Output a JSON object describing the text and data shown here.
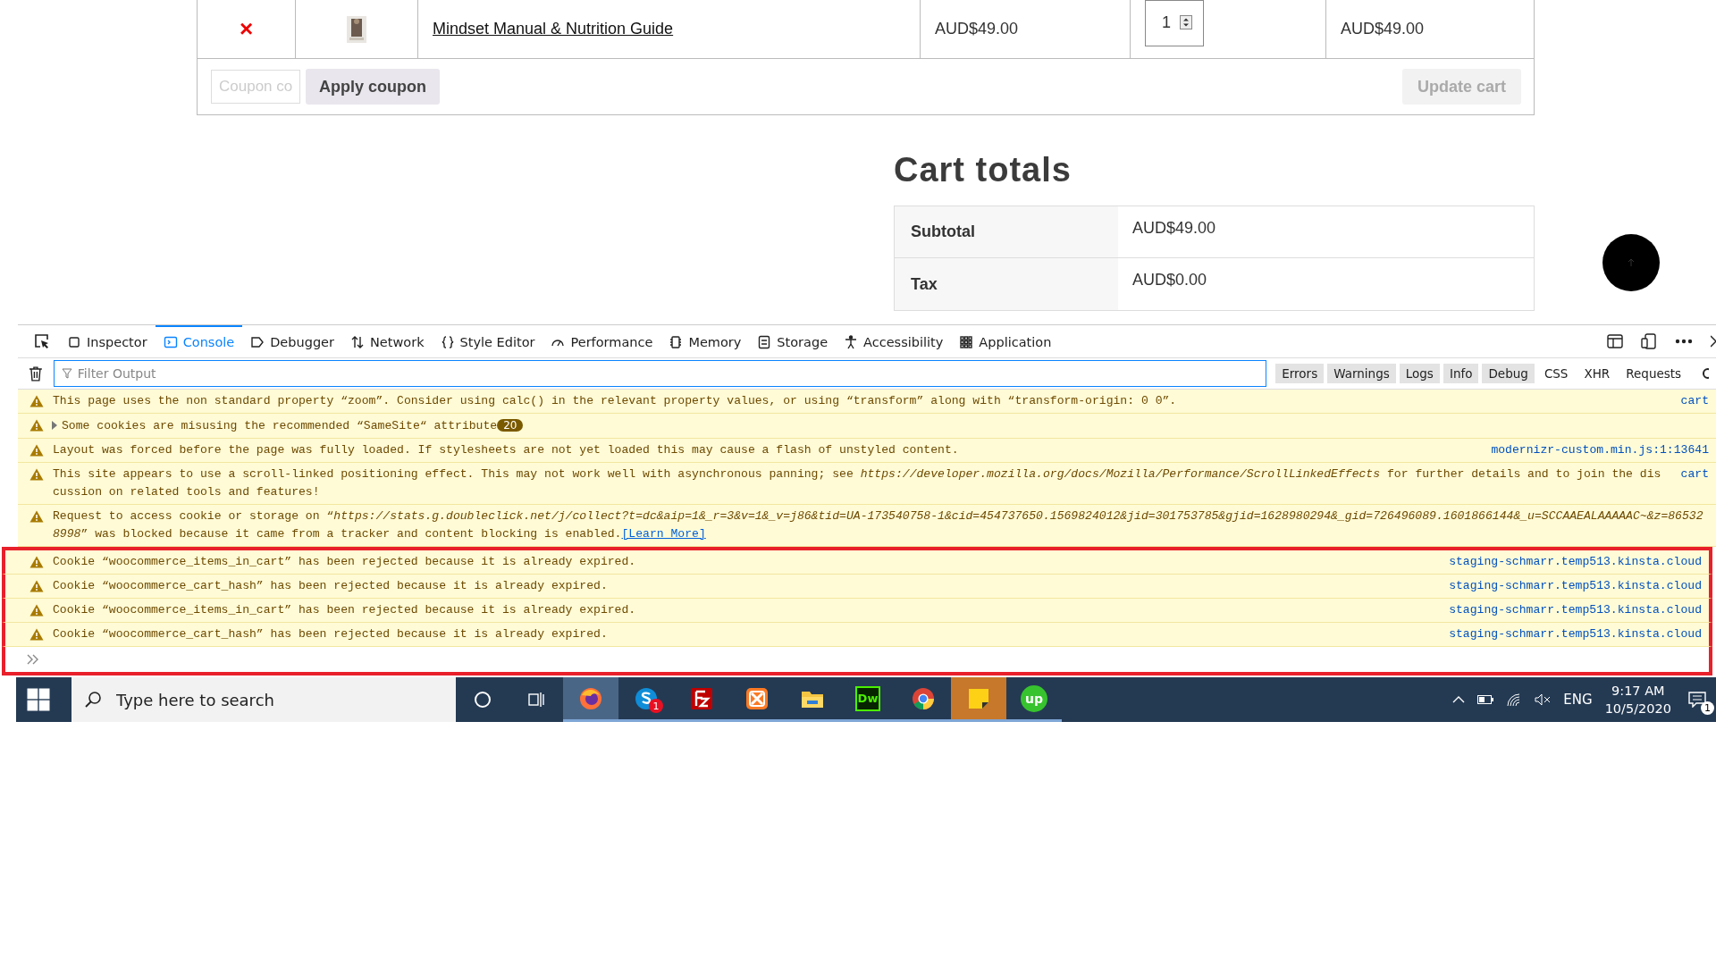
{
  "cart": {
    "rows": [
      {
        "remove": "×",
        "product": "Mindset Manual & Nutrition Guide",
        "price": "AUD$49.00",
        "quantity": "1",
        "subtotal": "AUD$49.00"
      }
    ],
    "coupon_placeholder": "Coupon co",
    "apply_button": "Apply coupon",
    "update_button": {
      "label": "Update cart",
      "disabled": true
    }
  },
  "cart_totals": {
    "title": "Cart totals",
    "rows": [
      {
        "label": "Subtotal",
        "value": "AUD$49.00"
      },
      {
        "label": "Tax",
        "value": "AUD$0.00"
      }
    ]
  },
  "devtools": {
    "tabs": [
      {
        "label": "Inspector",
        "selected": false
      },
      {
        "label": "Console",
        "selected": true
      },
      {
        "label": "Debugger",
        "selected": false
      },
      {
        "label": "Network",
        "selected": false
      },
      {
        "label": "Style Editor",
        "selected": false
      },
      {
        "label": "Performance",
        "selected": false
      },
      {
        "label": "Memory",
        "selected": false
      },
      {
        "label": "Storage",
        "selected": false
      },
      {
        "label": "Accessibility",
        "selected": false
      },
      {
        "label": "Application",
        "selected": false
      }
    ],
    "filter_placeholder": "Filter Output",
    "filters": [
      {
        "label": "Errors",
        "selected": true
      },
      {
        "label": "Warnings",
        "selected": true
      },
      {
        "label": "Logs",
        "selected": true
      },
      {
        "label": "Info",
        "selected": true
      },
      {
        "label": "Debug",
        "selected": true
      },
      {
        "label": "CSS",
        "selected": false
      },
      {
        "label": "XHR",
        "selected": false
      },
      {
        "label": "Requests",
        "selected": false
      }
    ],
    "messages": [
      {
        "text": "This page uses the non standard property “zoom”. Consider using calc() in the relevant property values, or using “transform” along with “transform-origin: 0 0”.",
        "source": "cart",
        "highlighted": false
      },
      {
        "text": "Some cookies are misusing the recommended “SameSite“ attribute",
        "expandable": true,
        "count": "20",
        "highlighted": false
      },
      {
        "text": "Layout was forced before the page was fully loaded. If stylesheets are not yet loaded this may cause a flash of unstyled content.",
        "source": "modernizr-custom.min.js:1:13641",
        "highlighted": false
      },
      {
        "text": "This site appears to use a scroll-linked positioning effect. This may not work well with asynchronous panning; see *https://developer.mozilla.org/docs/Mozilla/Performance/ScrollLinkedEffects* for further details and to join the discussion on related tools and features!",
        "source": "cart",
        "highlighted": false
      },
      {
        "text": "Request to access cookie or storage on “*https://stats.g.doubleclick.net/j/collect?t=dc&aip=1&_r=3&v=1&_v=j86&tid=UA-173540758-1&cid=454737650.1569824012&jid=301753785&gjid=1628980294&_gid=726496089.1601866144&_u=SCCAAEALAAAAAC~&z=865328998*” was blocked because it came from a tracker and content blocking is enabled.",
        "link": "[Learn More]",
        "highlighted": false
      },
      {
        "text": "Cookie “woocommerce_items_in_cart” has been rejected because it is already expired.",
        "source": "staging-schmarr.temp513.kinsta.cloud",
        "highlighted": true
      },
      {
        "text": "Cookie “woocommerce_cart_hash” has been rejected because it is already expired.",
        "source": "staging-schmarr.temp513.kinsta.cloud",
        "highlighted": true
      },
      {
        "text": "Cookie “woocommerce_items_in_cart” has been rejected because it is already expired.",
        "source": "staging-schmarr.temp513.kinsta.cloud",
        "highlighted": true
      },
      {
        "text": "Cookie “woocommerce_cart_hash” has been rejected because it is already expired.",
        "source": "staging-schmarr.temp513.kinsta.cloud",
        "highlighted": true
      }
    ]
  },
  "taskbar": {
    "search_placeholder": "Type here to search",
    "apps": [
      {
        "kind": "firefox",
        "selected": true
      },
      {
        "kind": "skype",
        "badge": "1",
        "selected": false
      },
      {
        "kind": "filezilla",
        "selected": false
      },
      {
        "kind": "xampp",
        "selected": false
      },
      {
        "kind": "explorer",
        "selected": false
      },
      {
        "kind": "dreamweaver",
        "label": "Dw",
        "selected": false
      },
      {
        "kind": "chrome",
        "selected": false
      },
      {
        "kind": "sticky",
        "selected": false,
        "flashing": true
      },
      {
        "kind": "upwork",
        "label": "up",
        "selected": false
      }
    ],
    "language": "ENG",
    "time": "9:17 AM",
    "date": "10/5/2020",
    "notifications": "1"
  }
}
